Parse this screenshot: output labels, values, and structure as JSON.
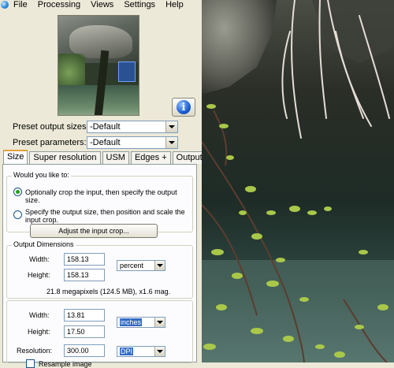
{
  "menu": {
    "items": [
      "File",
      "Processing",
      "Views",
      "Settings",
      "Help"
    ]
  },
  "presets": {
    "output_sizes_label": "Preset output sizes:",
    "output_sizes_value": "-Default",
    "parameters_label": "Preset parameters:",
    "parameters_value": "-Default"
  },
  "info_icon": "i",
  "tabs": [
    "Size",
    "Super resolution",
    "USM",
    "Edges +",
    "Output"
  ],
  "active_tab": "Size",
  "crop_group": {
    "title": "Would you like to:",
    "option1": "Optionally crop the input, then specify the output size.",
    "option2": "Specify the output size, then position and scale the input crop.",
    "selected": 1,
    "adjust_button": "Adjust the input crop..."
  },
  "output_dimensions": {
    "title": "Output Dimensions",
    "width_label": "Width:",
    "width_value": "158.13",
    "height_label": "Height:",
    "height_value": "158.13",
    "unit": "percent",
    "info_line": "21.8 megapixels (124.5 MB), x1.6 mag."
  },
  "physical": {
    "width_label": "Width:",
    "width_value": "13.81",
    "height_label": "Height:",
    "height_value": "17.50",
    "unit": "inches",
    "resolution_label": "Resolution:",
    "resolution_value": "300.00",
    "resolution_unit": "DPI",
    "resample_label": "Resample image"
  },
  "colors": {
    "window_bg": "#ece9d8",
    "panel_bg": "#fcfcfe",
    "active_tab_accent": "#e6a33c",
    "selection": "#316ac5"
  }
}
